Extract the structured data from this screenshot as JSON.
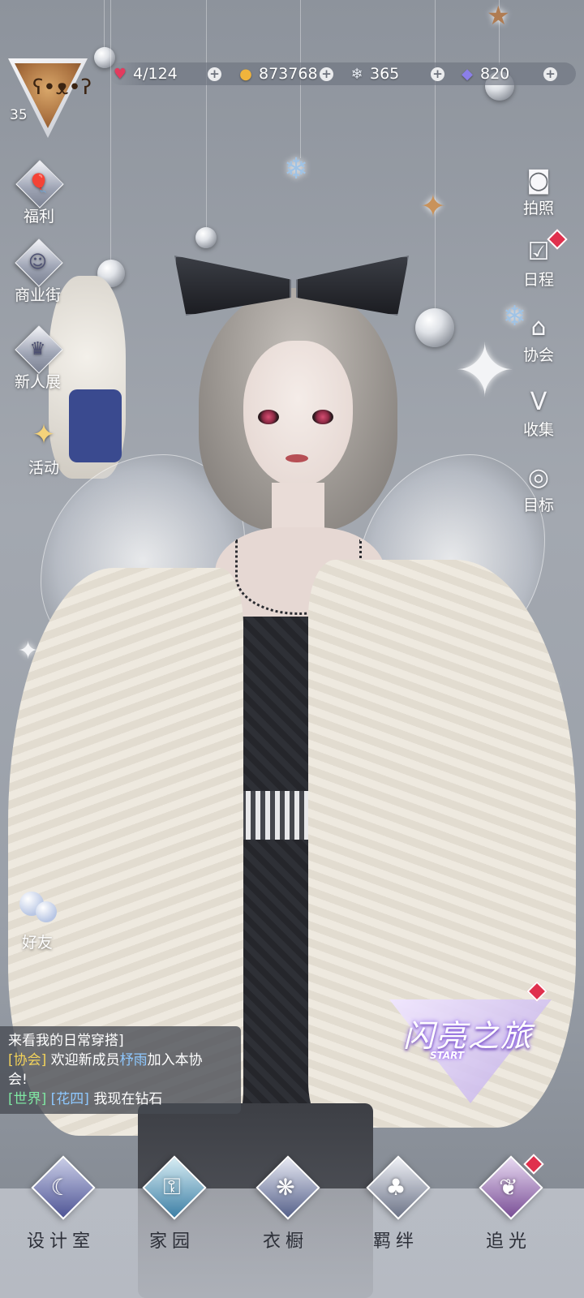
{
  "status": {
    "stamina": "4/124",
    "gold": "873768",
    "crystal": "365",
    "diamond": "820"
  },
  "player": {
    "level": "35"
  },
  "left_menu": {
    "welfare": "福利",
    "shop": "商业街",
    "new_exhibit": "新人展",
    "event": "活动",
    "friends": "好友"
  },
  "right_menu": {
    "photo": "拍照",
    "schedule": "日程",
    "guild": "协会",
    "collection": "收集",
    "goal": "目标"
  },
  "chat": {
    "line1": "来看我的日常穿搭]",
    "line2_tag": "[协会]",
    "line2_pre": "欢迎新成员",
    "line2_name": "杼雨",
    "line2_post": "加入本协",
    "line3": "会!",
    "line4_tag": "[世界]",
    "line4_name": "[花四]",
    "line4_msg": "我现在钻石"
  },
  "journey": {
    "title": "闪亮之旅",
    "sub": "START"
  },
  "bottom_nav": {
    "design": "设计室",
    "home": "家园",
    "wardrobe": "衣橱",
    "bond": "羁绊",
    "chase": "追光"
  }
}
